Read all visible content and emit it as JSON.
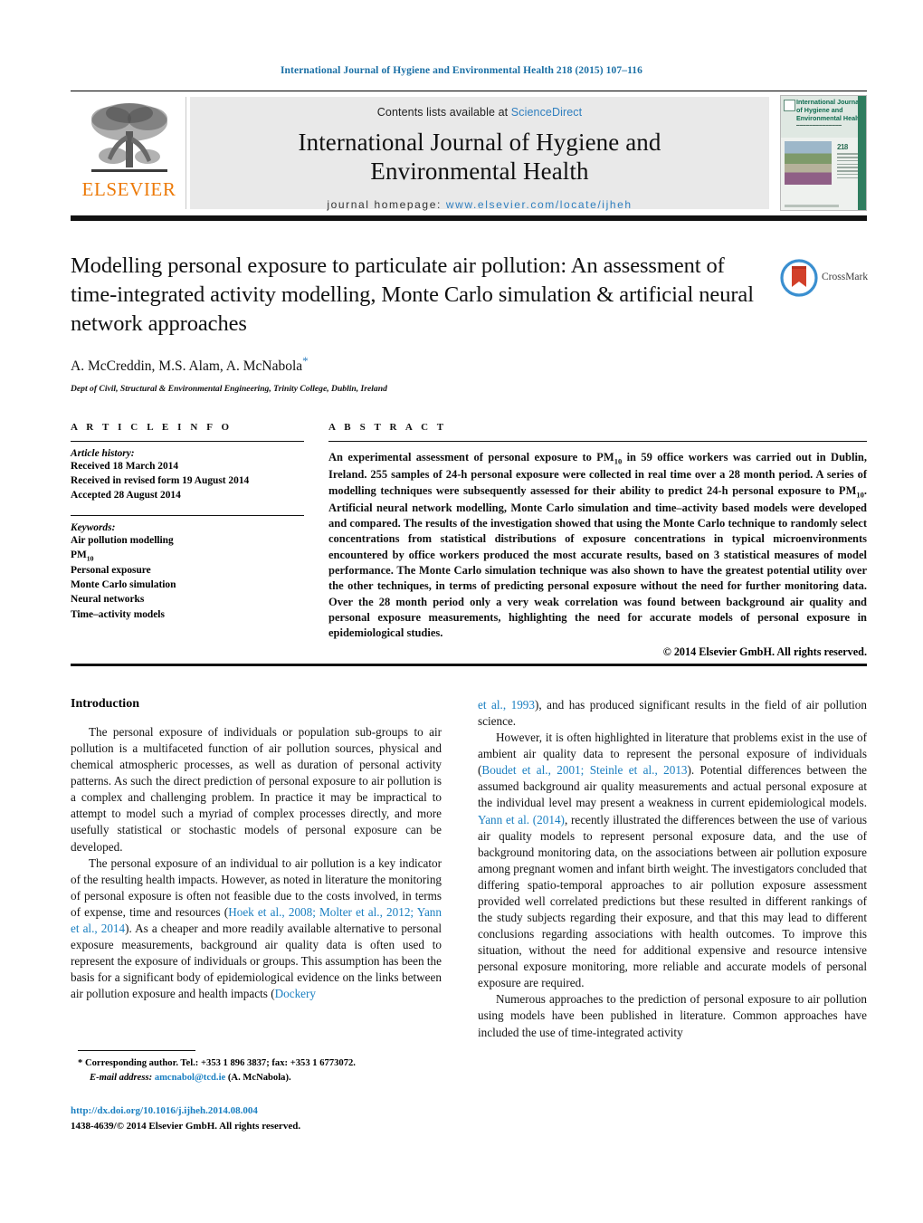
{
  "running_head": "International Journal of Hygiene and Environmental Health 218 (2015) 107–116",
  "masthead": {
    "publisher_logo_text": "ELSEVIER",
    "contents_prefix": "Contents lists available at ",
    "contents_link": "ScienceDirect",
    "journal_title_line1": "International Journal of Hygiene and",
    "journal_title_line2": "Environmental Health",
    "homepage_label": "journal homepage: ",
    "homepage_url": "www.elsevier.com/locate/ijheh",
    "cover": {
      "title_line1": "International Journal",
      "title_line2": "of Hygiene and",
      "title_line3": "Environmental Health",
      "issue_number": "218"
    }
  },
  "article": {
    "title": "Modelling personal exposure to particulate air pollution: An assessment of time-integrated activity modelling, Monte Carlo simulation & artificial neural network approaches",
    "authors": "A. McCreddin, M.S. Alam, A. McNabola",
    "corresponding_marker": "*",
    "affiliation": "Dept of Civil, Structural & Environmental Engineering, Trinity College, Dublin, Ireland",
    "crossmark_label": "CrossMark"
  },
  "article_info": {
    "heading": "A R T I C L E   I N F O",
    "history_label": "Article history:",
    "history": [
      "Received 18 March 2014",
      "Received in revised form 19 August 2014",
      "Accepted 28 August 2014"
    ],
    "keywords_label": "Keywords:",
    "keywords": [
      "Air pollution modelling",
      "PM10",
      "Personal exposure",
      "Monte Carlo simulation",
      "Neural networks",
      "Time–activity models"
    ]
  },
  "abstract": {
    "heading": "A B S T R A C T",
    "text": "An experimental assessment of personal exposure to PM10 in 59 office workers was carried out in Dublin, Ireland. 255 samples of 24-h personal exposure were collected in real time over a 28 month period. A series of modelling techniques were subsequently assessed for their ability to predict 24-h personal exposure to PM10. Artificial neural network modelling, Monte Carlo simulation and time–activity based models were developed and compared. The results of the investigation showed that using the Monte Carlo technique to randomly select concentrations from statistical distributions of exposure concentrations in typical microenvironments encountered by office workers produced the most accurate results, based on 3 statistical measures of model performance. The Monte Carlo simulation technique was also shown to have the greatest potential utility over the other techniques, in terms of predicting personal exposure without the need for further monitoring data. Over the 28 month period only a very weak correlation was found between background air quality and personal exposure measurements, highlighting the need for accurate models of personal exposure in epidemiological studies.",
    "copyright": "© 2014 Elsevier GmbH. All rights reserved."
  },
  "body": {
    "intro_heading": "Introduction",
    "left_paragraphs": [
      "The personal exposure of individuals or population sub-groups to air pollution is a multifaceted function of air pollution sources, physical and chemical atmospheric processes, as well as duration of personal activity patterns. As such the direct prediction of personal exposure to air pollution is a complex and challenging problem. In practice it may be impractical to attempt to model such a myriad of complex processes directly, and more usefully statistical or stochastic models of personal exposure can be developed.",
      "The personal exposure of an individual to air pollution is a key indicator of the resulting health impacts. However, as noted in literature the monitoring of personal exposure is often not feasible due to the costs involved, in terms of expense, time and resources (Hoek et al., 2008; Molter et al., 2012; Yann et al., 2014). As a cheaper and more readily available alternative to personal exposure measurements, background air quality data is often used to represent the exposure of individuals or groups. This assumption has been the basis for a significant body of epidemiological evidence on the links between air pollution exposure and health impacts (Dockery"
    ],
    "left_citations": [
      "Hoek et al., 2008; Molter et al., 2012; Yann et al., 2014",
      "Dockery"
    ],
    "right_paragraphs": [
      "et al., 1993), and has produced significant results in the field of air pollution science.",
      "However, it is often highlighted in literature that problems exist in the use of ambient air quality data to represent the personal exposure of individuals (Boudet et al., 2001; Steinle et al., 2013). Potential differences between the assumed background air quality measurements and actual personal exposure at the individual level may present a weakness in current epidemiological models. Yann et al. (2014), recently illustrated the differences between the use of various air quality models to represent personal exposure data, and the use of background monitoring data, on the associations between air pollution exposure among pregnant women and infant birth weight. The investigators concluded that differing spatio-temporal approaches to air pollution exposure assessment provided well correlated predictions but these resulted in different rankings of the study subjects regarding their exposure, and that this may lead to different conclusions regarding associations with health outcomes. To improve this situation, without the need for additional expensive and resource intensive personal exposure monitoring, more reliable and accurate models of personal exposure are required.",
      "Numerous approaches to the prediction of personal exposure to air pollution using models have been published in literature. Common approaches have included the use of time-integrated activity"
    ],
    "right_citations": [
      "et al., 1993",
      "Boudet et al., 2001; Steinle et al., 2013",
      "Yann et al. (2014)"
    ]
  },
  "footnotes": {
    "corresponding": "* Corresponding author. Tel.: +353 1 896 3837; fax: +353 1 6773072.",
    "email_label": "E-mail address:",
    "email": "amcnabol@tcd.ie",
    "email_suffix": "(A. McNabola).",
    "doi": "http://dx.doi.org/10.1016/j.ijheh.2014.08.004",
    "issn_line": "1438-4639/© 2014 Elsevier GmbH. All rights reserved."
  },
  "colors": {
    "link_blue": "#1a7fc1",
    "elsevier_orange": "#ec7a08",
    "heading_blue": "#1a6fa5"
  }
}
